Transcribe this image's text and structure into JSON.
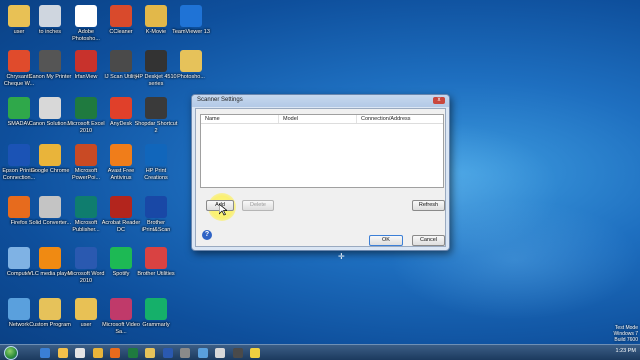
{
  "desktop": {
    "icons": [
      {
        "label": "user",
        "icon": "user-folder-icon",
        "color": "#e8c155"
      },
      {
        "label": "to inches",
        "icon": "recycle-bin-icon",
        "color": "#cfd6df"
      },
      {
        "label": "Adobe Photosho...",
        "icon": "adobe-photoshop-icon",
        "color": "#ffffff"
      },
      {
        "label": "CCleaner",
        "icon": "ccleaner-icon",
        "color": "#d94a2c"
      },
      {
        "label": "K-Movie",
        "icon": "film-folder-icon",
        "color": "#e2b84a"
      },
      {
        "label": "TeamViewer 13",
        "icon": "teamviewer-icon",
        "color": "#1f73d6"
      },
      {
        "label": "Chrysanth Cheque W...",
        "icon": "cheque-writer-icon",
        "color": "#e04b2c"
      },
      {
        "label": "Canon My Printer",
        "icon": "printer-icon",
        "color": "#555555"
      },
      {
        "label": "IrfanView",
        "icon": "irfanview-icon",
        "color": "#c8322c"
      },
      {
        "label": "IJ Scan Utility",
        "icon": "scanner-icon",
        "color": "#4a4a4a"
      },
      {
        "label": "HP Deskjet 4510 series",
        "icon": "hp-printer-icon",
        "color": "#333333"
      },
      {
        "label": "Photosho...",
        "icon": "folder-icon",
        "color": "#e6c25a"
      },
      {
        "label": "SMADAV",
        "icon": "smadav-icon",
        "color": "#2fa84a"
      },
      {
        "label": "Canon Solution...",
        "icon": "canon-icon",
        "color": "#d8d8d8"
      },
      {
        "label": "Microsoft Excel 2010",
        "icon": "excel-icon",
        "color": "#1f7a3f"
      },
      {
        "label": "AnyDesk",
        "icon": "anydesk-icon",
        "color": "#e0402a"
      },
      {
        "label": "Shopdar Shortcut 2",
        "icon": "shop-icon",
        "color": "#3a3a3a"
      },
      {
        "label": "Epson Printer Connection...",
        "icon": "epson-icon",
        "color": "#1b53b5"
      },
      {
        "label": "Google Chrome",
        "icon": "chrome-icon",
        "color": "#e9b43a"
      },
      {
        "label": "Microsoft PowerPoi...",
        "icon": "powerpoint-icon",
        "color": "#c94a24"
      },
      {
        "label": "Avast Free Antivirus",
        "icon": "avast-icon",
        "color": "#f07d1a"
      },
      {
        "label": "HP Print Creations",
        "icon": "hp-creations-icon",
        "color": "#1166bb"
      },
      {
        "label": "Firefox",
        "icon": "firefox-icon",
        "color": "#e76b1d"
      },
      {
        "label": "Solid Converter...",
        "icon": "solid-converter-icon",
        "color": "#c4c4c4"
      },
      {
        "label": "Microsoft Publisher...",
        "icon": "publisher-icon",
        "color": "#0f7d6e"
      },
      {
        "label": "Acrobat Reader DC",
        "icon": "acrobat-icon",
        "color": "#b3251d"
      },
      {
        "label": "Brother iPrint&Scan",
        "icon": "brother-icon",
        "color": "#1948a6"
      },
      {
        "label": "Computer",
        "icon": "computer-icon",
        "color": "#7fb2e4"
      },
      {
        "label": "VLC media player",
        "icon": "vlc-icon",
        "color": "#f08a12"
      },
      {
        "label": "Microsoft Word 2010",
        "icon": "word-icon",
        "color": "#2a59b0"
      },
      {
        "label": "Spotify",
        "icon": "spotify-icon",
        "color": "#1db954"
      },
      {
        "label": "Brother Utilities",
        "icon": "brother-utilities-icon",
        "color": "#d94242"
      },
      {
        "label": "Network",
        "icon": "network-icon",
        "color": "#5aa0dd"
      },
      {
        "label": "Custom Program",
        "icon": "program-folder-icon",
        "color": "#e6c25a"
      },
      {
        "label": "user",
        "icon": "user-folder-icon",
        "color": "#e8c155"
      },
      {
        "label": "Microsoft Video Sa...",
        "icon": "video-icon",
        "color": "#c03a6a"
      },
      {
        "label": "Grammarly",
        "icon": "grammarly-icon",
        "color": "#15b06a"
      }
    ]
  },
  "dialog": {
    "title": "Scanner Settings",
    "close_label": "x",
    "columns": [
      "Name",
      "Model",
      "Connection/Address"
    ],
    "buttons": {
      "add": "Add",
      "delete": "Delete",
      "refresh": "Refresh",
      "ok": "OK",
      "cancel": "Cancel"
    },
    "help_label": "?"
  },
  "taskbar": {
    "time": "1:23 PM",
    "apps": [
      "start-icon",
      "ie-icon",
      "explorer-icon",
      "media-icon",
      "chrome-icon",
      "firefox-icon",
      "excel-icon",
      "folder-icon",
      "word-icon",
      "settings-icon",
      "photo-icon",
      "canon-icon",
      "scanner-icon",
      "mail-icon"
    ]
  },
  "watermark": {
    "line1": "Test Mode",
    "line2": "Windows 7",
    "line3": "Build 7600"
  }
}
